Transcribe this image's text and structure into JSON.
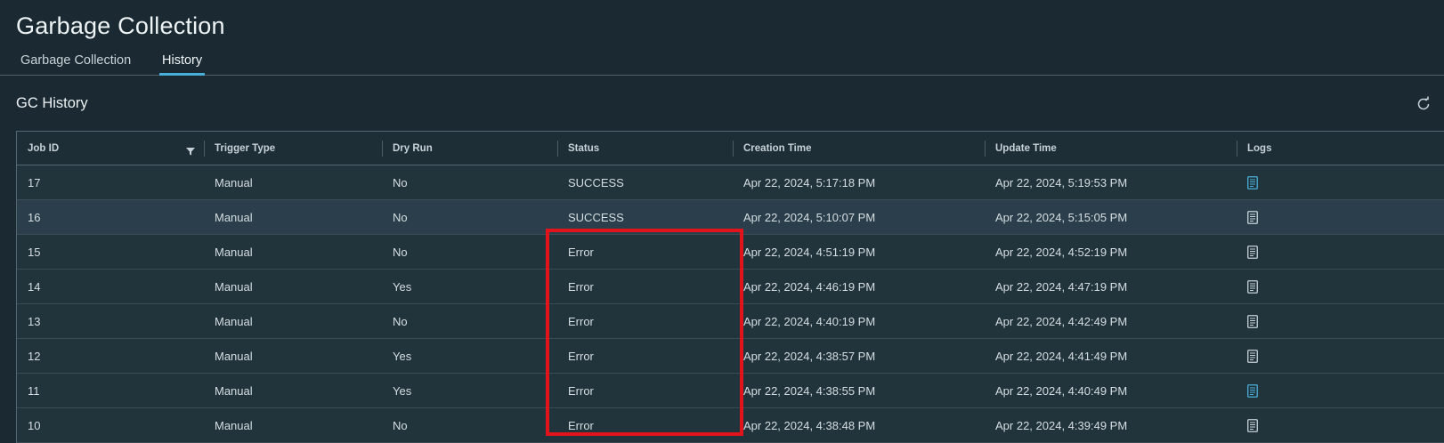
{
  "page": {
    "title": "Garbage Collection"
  },
  "tabs": [
    {
      "label": "Garbage Collection",
      "active": false
    },
    {
      "label": "History",
      "active": true
    }
  ],
  "section": {
    "title": "GC History",
    "refresh_icon": "refresh-icon"
  },
  "table": {
    "columns": [
      "Job ID",
      "Trigger Type",
      "Dry Run",
      "Status",
      "Creation Time",
      "Update Time",
      "Logs"
    ],
    "filter_icon": "filter-icon",
    "log_icon": "document-icon",
    "rows": [
      {
        "job_id": "17",
        "trigger": "Manual",
        "dry_run": "No",
        "status": "SUCCESS",
        "created": "Apr 22, 2024, 5:17:18 PM",
        "updated": "Apr 22, 2024, 5:19:53 PM"
      },
      {
        "job_id": "16",
        "trigger": "Manual",
        "dry_run": "No",
        "status": "SUCCESS",
        "created": "Apr 22, 2024, 5:10:07 PM",
        "updated": "Apr 22, 2024, 5:15:05 PM"
      },
      {
        "job_id": "15",
        "trigger": "Manual",
        "dry_run": "No",
        "status": "Error",
        "created": "Apr 22, 2024, 4:51:19 PM",
        "updated": "Apr 22, 2024, 4:52:19 PM"
      },
      {
        "job_id": "14",
        "trigger": "Manual",
        "dry_run": "Yes",
        "status": "Error",
        "created": "Apr 22, 2024, 4:46:19 PM",
        "updated": "Apr 22, 2024, 4:47:19 PM"
      },
      {
        "job_id": "13",
        "trigger": "Manual",
        "dry_run": "No",
        "status": "Error",
        "created": "Apr 22, 2024, 4:40:19 PM",
        "updated": "Apr 22, 2024, 4:42:49 PM"
      },
      {
        "job_id": "12",
        "trigger": "Manual",
        "dry_run": "Yes",
        "status": "Error",
        "created": "Apr 22, 2024, 4:38:57 PM",
        "updated": "Apr 22, 2024, 4:41:49 PM"
      },
      {
        "job_id": "11",
        "trigger": "Manual",
        "dry_run": "Yes",
        "status": "Error",
        "created": "Apr 22, 2024, 4:38:55 PM",
        "updated": "Apr 22, 2024, 4:40:49 PM"
      },
      {
        "job_id": "10",
        "trigger": "Manual",
        "dry_run": "No",
        "status": "Error",
        "created": "Apr 22, 2024, 4:38:48 PM",
        "updated": "Apr 22, 2024, 4:39:49 PM"
      }
    ]
  },
  "colors": {
    "background": "#1b2a32",
    "tab_active_underline": "#49afd9",
    "row_highlight": "#2a3f4b",
    "annotation_box": "#e0141a",
    "log_icon_active": "#49afd9",
    "log_icon_default": "#c6d2d8"
  }
}
